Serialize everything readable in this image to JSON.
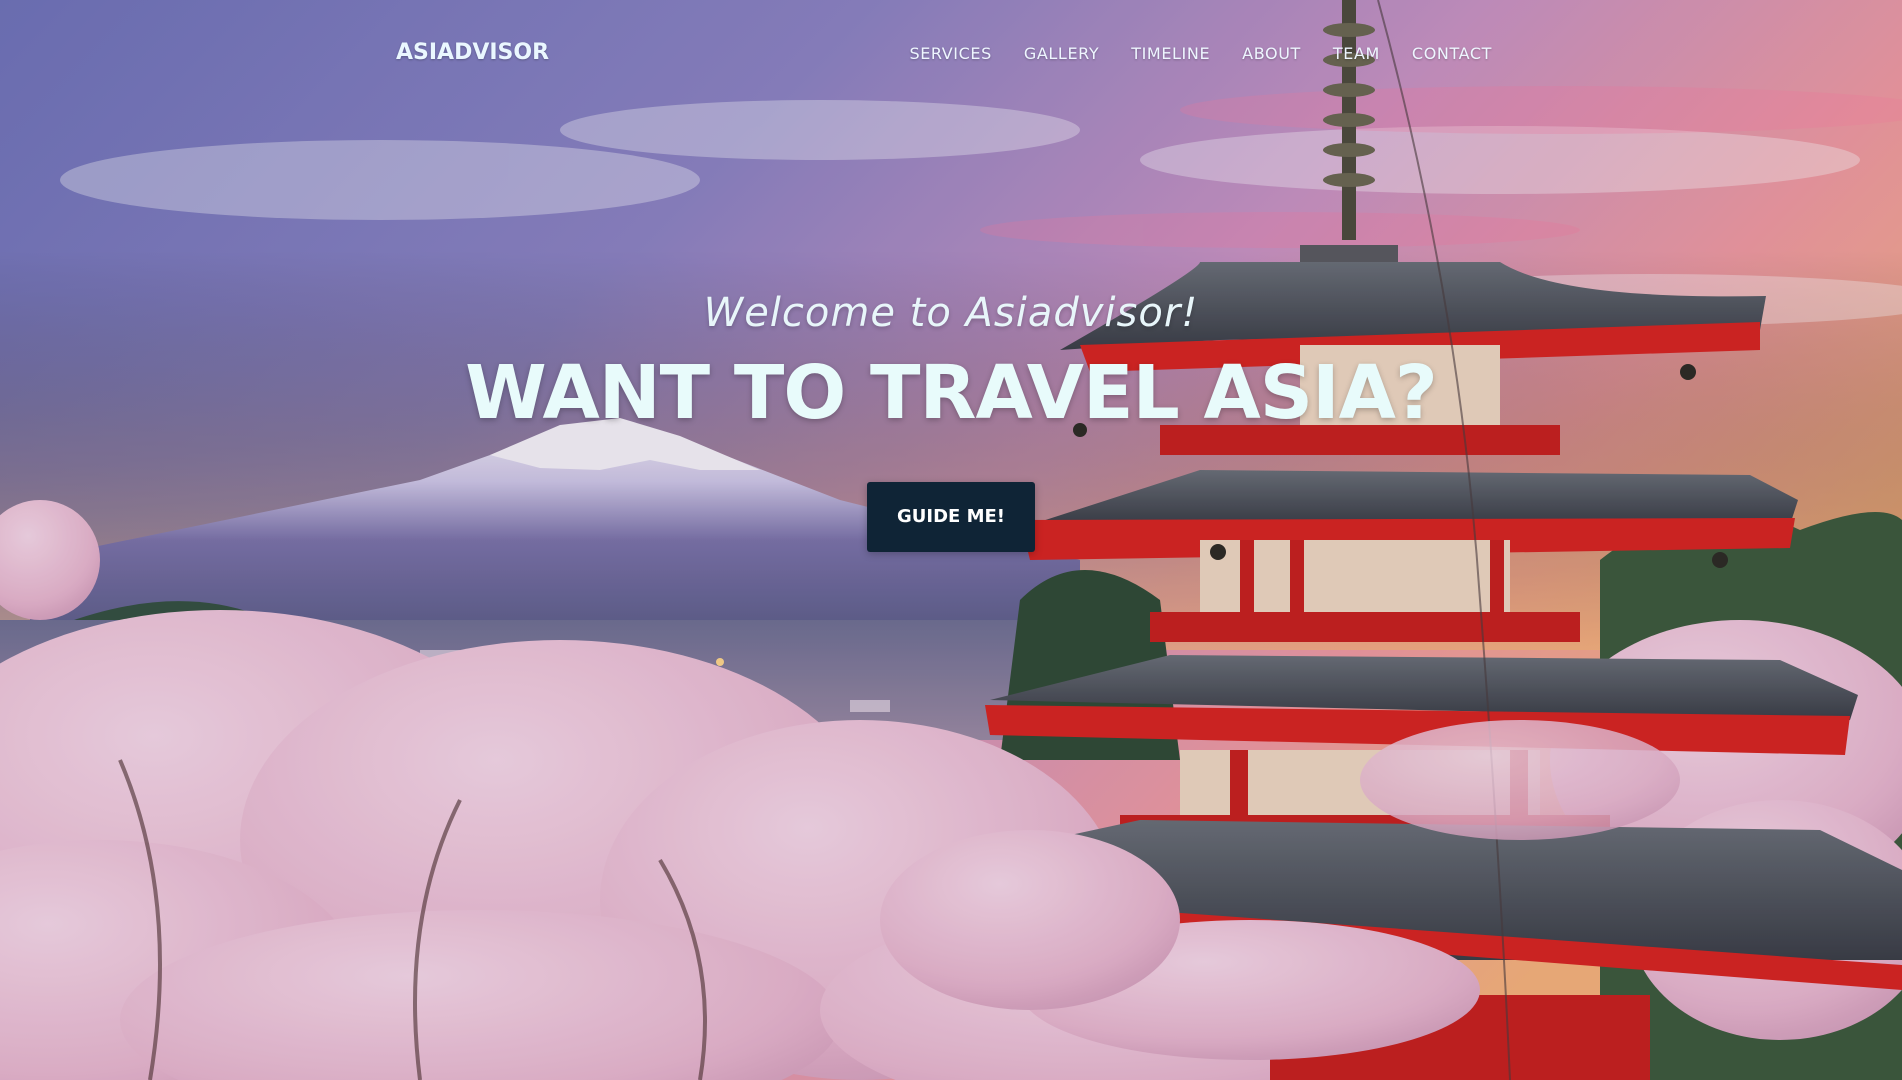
{
  "navbar": {
    "brand": "ASIADVISOR",
    "links": [
      {
        "label": "SERVICES"
      },
      {
        "label": "GALLERY"
      },
      {
        "label": "TIMELINE"
      },
      {
        "label": "ABOUT"
      },
      {
        "label": "TEAM"
      },
      {
        "label": "CONTACT"
      }
    ]
  },
  "hero": {
    "subtitle": "Welcome to Asiadvisor!",
    "title": "WANT TO TRAVEL ASIA?",
    "cta_label": "GUIDE ME!",
    "background_description": "pagoda-mountain-cherry-blossom-photo"
  },
  "colors": {
    "nav_text": "#eef6ff",
    "title_text": "#e8fbfb",
    "cta_background": "#0f2436",
    "cta_text": "#ffffff",
    "pagoda_red": "#d8231f",
    "blossom_pink": "#f1c6d8",
    "sky_purple": "#7d7fc0",
    "sky_orange": "#f6a476"
  }
}
